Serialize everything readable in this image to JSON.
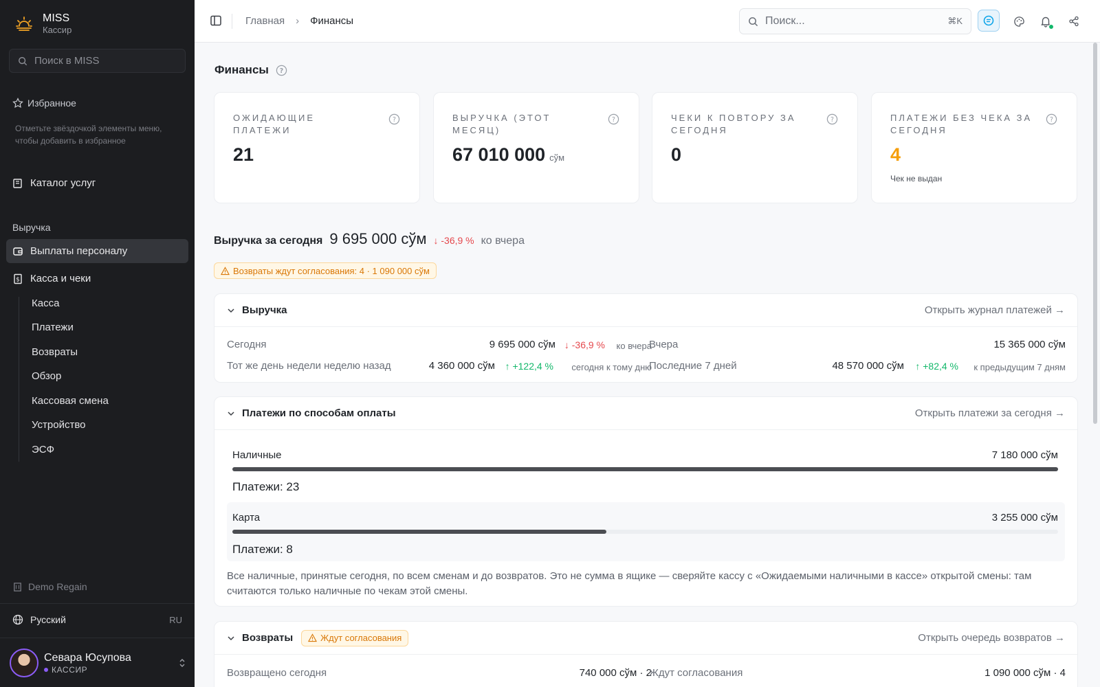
{
  "sidebar": {
    "brand": {
      "name": "MISS",
      "role": "Кассир"
    },
    "search_placeholder": "Поиск в MISS",
    "favorites": {
      "title": "Избранное",
      "hint": "Отметьте звёздочкой элементы меню, чтобы добавить в избранное"
    },
    "catalog": "Каталог услуг",
    "section": "Выручка",
    "items": {
      "staff_payouts": "Выплаты персоналу",
      "cash_checks": "Касса и чеки"
    },
    "sub_items": [
      "Касса",
      "Платежи",
      "Возвраты",
      "Обзор",
      "Кассовая смена",
      "Устройство",
      "ЭСФ"
    ],
    "org": "Demo Regain",
    "language": {
      "label": "Русский",
      "code": "RU"
    },
    "user": {
      "name": "Севара Юсупова",
      "role": "КАССИР"
    }
  },
  "topbar": {
    "breadcrumb": {
      "home": "Главная",
      "separator": "›",
      "current": "Финансы"
    },
    "search_placeholder": "Поиск...",
    "shortcut": "⌘K"
  },
  "page": {
    "title": "Финансы"
  },
  "kpis": [
    {
      "label": "ОЖИДАЮЩИЕ ПЛАТЕЖИ",
      "value": "21",
      "unit": "",
      "note": ""
    },
    {
      "label": "ВЫРУЧКА (ЭТОТ МЕСЯЦ)",
      "value": "67 010 000",
      "unit": "сўм",
      "note": ""
    },
    {
      "label": "ЧЕКИ К ПОВТОРУ ЗА СЕГОДНЯ",
      "value": "0",
      "unit": "",
      "note": ""
    },
    {
      "label": "ПЛАТЕЖИ БЕЗ ЧЕКА ЗА СЕГОДНЯ",
      "value": "4",
      "unit": "",
      "note": "Чек не выдан"
    }
  ],
  "today": {
    "label": "Выручка за сегодня",
    "value": "9 695 000 сўм",
    "delta": "↓ -36,9 %",
    "suffix": "ко вчера"
  },
  "refund_warning": "Возвраты ждут согласования: 4 · 1 090 000 сўм",
  "revenue_card": {
    "title": "Выручка",
    "link": "Открыть журнал платежей →",
    "today": {
      "label": "Сегодня",
      "value": "9 695 000 сўм",
      "delta": "↓ -36,9 %",
      "note": "ко вчера"
    },
    "yesterday": {
      "label": "Вчера",
      "value": "15 365 000 сўм"
    },
    "week_ago": {
      "label": "Тот же день недели неделю назад",
      "value": "4 360 000 сўм",
      "delta": "↑ +122,4 %",
      "note": "сегодня к тому дню"
    },
    "last7": {
      "label": "Последние 7 дней",
      "value": "48 570 000 сўм",
      "delta": "↑ +82,4 %",
      "note": "к предыдущим 7 дням"
    }
  },
  "payments_card": {
    "title": "Платежи по способам оплаты",
    "link": "Открыть платежи за сегодня →",
    "methods": [
      {
        "name": "Наличные",
        "amount": "7 180 000 сўм",
        "count": "Платежи: 23",
        "share": 1.0
      },
      {
        "name": "Карта",
        "amount": "3 255 000 сўм",
        "count": "Платежи: 8",
        "share": 0.453
      }
    ],
    "note": "Все наличные, принятые сегодня, по всем сменам и до возвратов. Это не сумма в ящике — сверяйте кассу с «Ожидаемыми наличными в кассе» открытой смены: там считаются только наличные по чекам этой смены."
  },
  "refunds_card": {
    "title": "Возвраты",
    "badge": "Ждут согласования",
    "link": "Открыть очередь возвратов →",
    "returned": {
      "label": "Возвращено сегодня",
      "value": "740 000 сўм · 2"
    },
    "pending": {
      "label": "Ждут согласования",
      "value": "1 090 000 сўм · 4"
    }
  },
  "colors": {
    "accent_orange": "#f59e0b",
    "negative": "#e5484d",
    "positive": "#12b76a",
    "sidebar_bg": "#1c1d20"
  }
}
